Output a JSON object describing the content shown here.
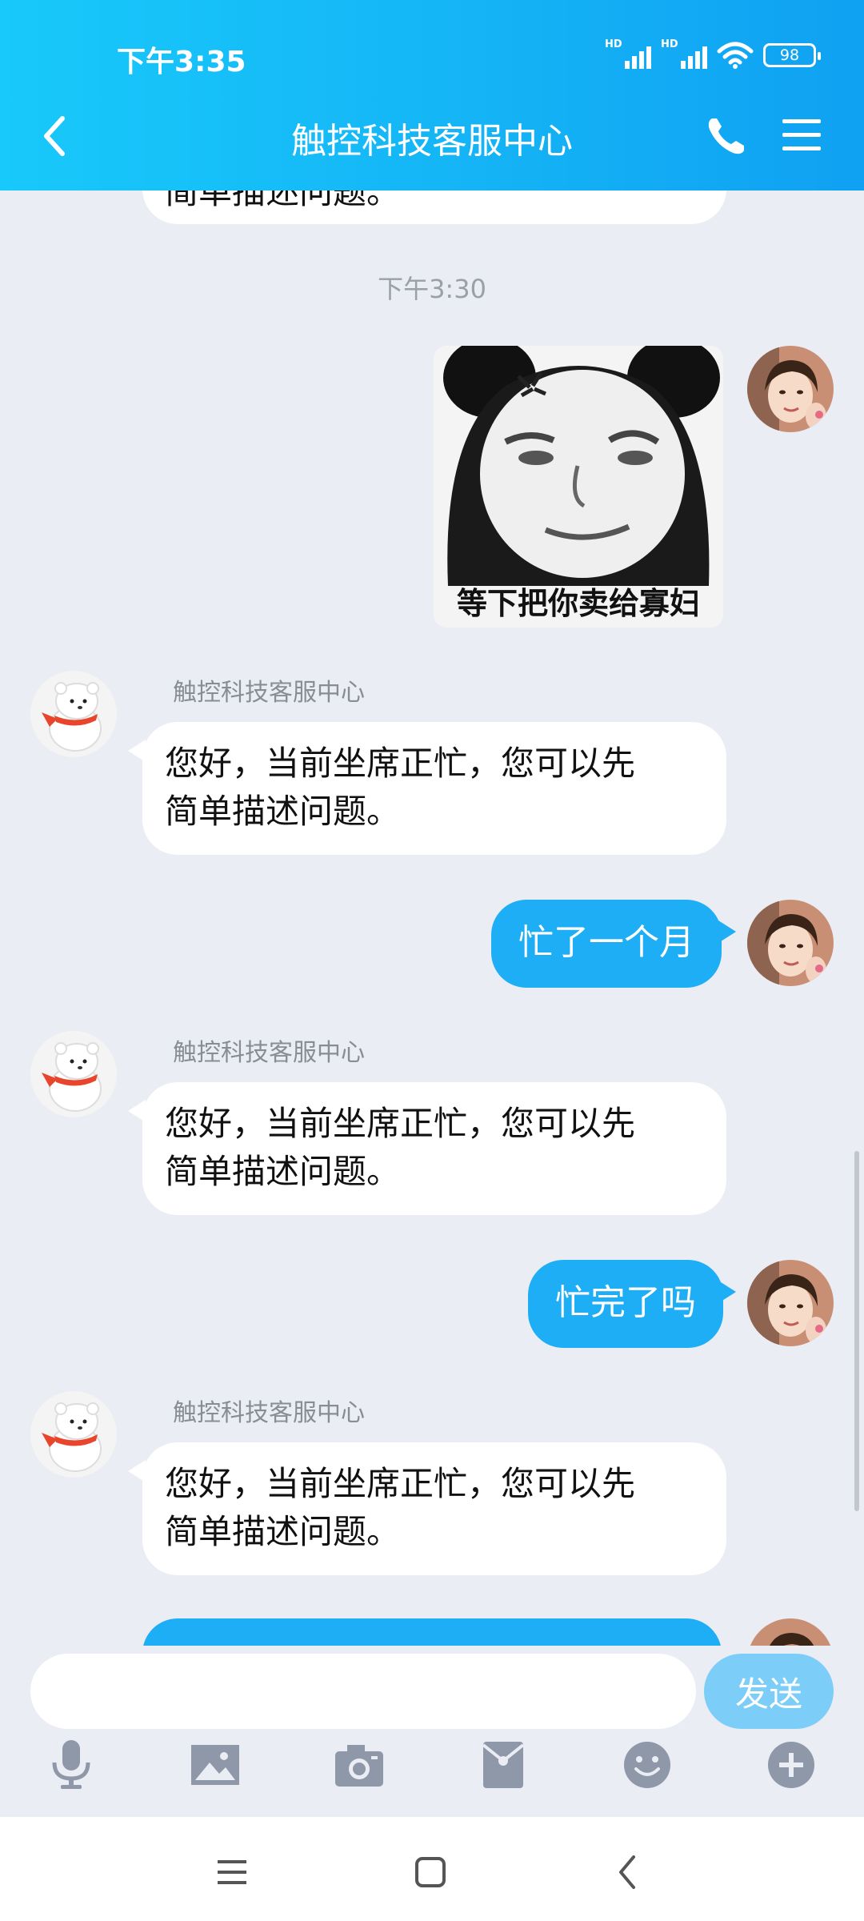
{
  "status": {
    "time": "下午3:35",
    "hd1": "HD",
    "hd2": "HD",
    "battery": "98"
  },
  "header": {
    "title": "触控科技客服中心"
  },
  "messages": {
    "partial_top": "简单描述问题。",
    "time_separator": "下午3:30",
    "meme_caption": "等下把你卖给寡妇",
    "bot_sender": "触控科技客服中心",
    "bot_reply_line1": "您好，当前坐席正忙，您可以先",
    "bot_reply_line2": "简单描述问题。",
    "user_msg_1": "忙了一个月",
    "user_msg_2": "忙完了吗"
  },
  "input": {
    "placeholder": "",
    "value": "",
    "send_label": "发送"
  },
  "toolbar": {
    "icons": [
      "microphone-icon",
      "image-icon",
      "camera-icon",
      "red-packet-icon",
      "emoji-icon",
      "plus-icon"
    ]
  },
  "colors": {
    "header_start": "#18c9fb",
    "header_end": "#0fa1f2",
    "user_bubble": "#1eaef5",
    "bot_bubble": "#ffffff",
    "background": "#eaedf4",
    "send_button": "#7ccdf7"
  }
}
